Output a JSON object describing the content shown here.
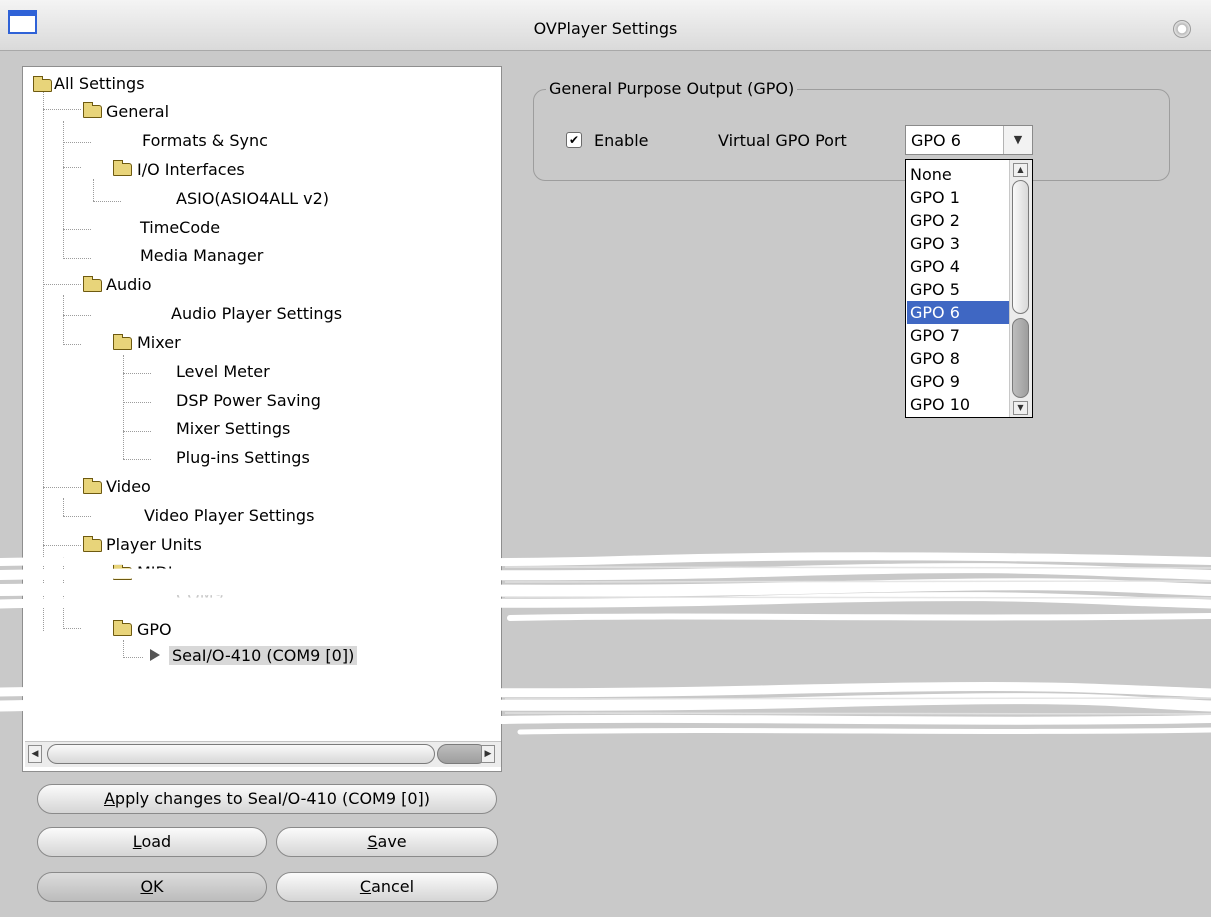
{
  "window": {
    "title": "OVPlayer Settings"
  },
  "tree": {
    "items": [
      {
        "label": "All Settings"
      },
      {
        "label": "General"
      },
      {
        "label": "Formats & Sync"
      },
      {
        "label": "I/O Interfaces"
      },
      {
        "label": "ASIO(ASIO4ALL v2)"
      },
      {
        "label": "TimeCode"
      },
      {
        "label": "Media Manager"
      },
      {
        "label": "Audio"
      },
      {
        "label": "Audio Player Settings"
      },
      {
        "label": "Mixer"
      },
      {
        "label": "Level Meter"
      },
      {
        "label": "DSP Power Saving"
      },
      {
        "label": "Mixer Settings"
      },
      {
        "label": "Plug-ins Settings"
      },
      {
        "label": "Video"
      },
      {
        "label": "Video Player Settings"
      },
      {
        "label": "Player Units"
      },
      {
        "label": "MIDI"
      },
      {
        "label": "COM9"
      },
      {
        "label": "GPO"
      },
      {
        "label": "SeaI/O-410 (COM9 [0])"
      }
    ]
  },
  "buttons": {
    "apply": {
      "pre": "",
      "key": "A",
      "post": "pply changes to SeaI/O-410 (COM9 [0])"
    },
    "load": {
      "pre": "",
      "key": "L",
      "post": "oad"
    },
    "save": {
      "pre": "",
      "key": "S",
      "post": "ave"
    },
    "ok": {
      "pre": "",
      "key": "O",
      "post": "K"
    },
    "cancel": {
      "pre": "",
      "key": "C",
      "post": "ancel"
    }
  },
  "gpo": {
    "legend": "General Purpose Output (GPO)",
    "enable_label": "Enable",
    "enable_checked": true,
    "port_label": "Virtual GPO Port",
    "selected": "GPO 6",
    "options": [
      "None",
      "GPO 1",
      "GPO 2",
      "GPO 3",
      "GPO 4",
      "GPO 5",
      "GPO 6",
      "GPO 7",
      "GPO 8",
      "GPO 9",
      "GPO 10"
    ]
  },
  "icons": {
    "up": "▲",
    "down": "▼",
    "left": "◀",
    "right": "▶",
    "check": "✔"
  }
}
